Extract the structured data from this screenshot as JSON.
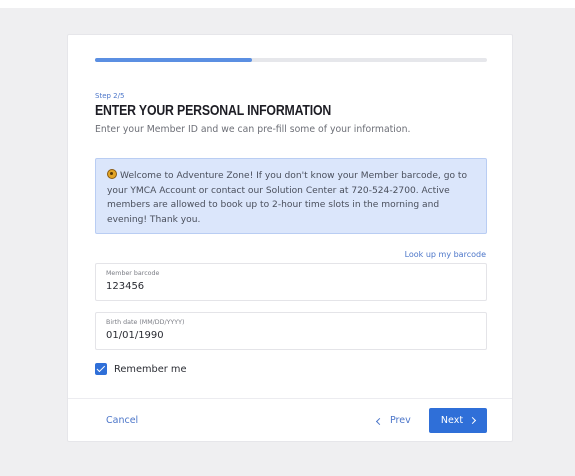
{
  "progress": {
    "fraction": 0.4
  },
  "header": {
    "step": "Step 2/5",
    "title": "ENTER YOUR PERSONAL INFORMATION",
    "subtitle": "Enter your Member ID and we can pre-fill some of your information."
  },
  "info": {
    "icon": "smiley-icon",
    "text": "Welcome to Adventure Zone! If you don't know your Member barcode, go to your YMCA Account or contact our Solution Center at 720-524-2700. Active members are allowed to book up to 2-hour time slots in the morning and evening! Thank you."
  },
  "lookup_link": "Look up my barcode",
  "fields": {
    "barcode": {
      "label": "Member barcode",
      "value": "123456"
    },
    "birth": {
      "label": "Birth date (MM/DD/YYYY)",
      "value": "01/01/1990"
    }
  },
  "remember": {
    "label": "Remember me",
    "checked": true
  },
  "footer": {
    "cancel": "Cancel",
    "prev": "Prev",
    "next": "Next"
  },
  "colors": {
    "accent": "#2f6fd8",
    "link": "#4c76c9",
    "info_bg": "#dbe6fb"
  }
}
